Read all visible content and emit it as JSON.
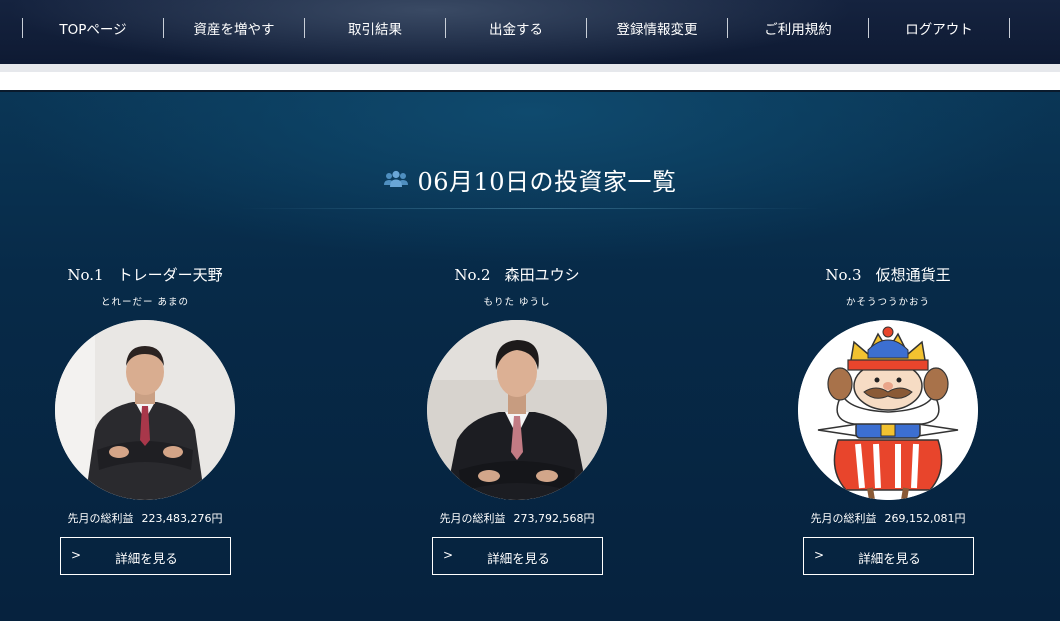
{
  "nav": {
    "items": [
      {
        "label": "TOPページ"
      },
      {
        "label": "資産を増やす"
      },
      {
        "label": "取引結果"
      },
      {
        "label": "出金する"
      },
      {
        "label": "登録情報変更"
      },
      {
        "label": "ご利用規約"
      },
      {
        "label": "ログアウト"
      }
    ]
  },
  "section": {
    "title": "06月10日の投資家一覧",
    "icon": "users-icon"
  },
  "investors": [
    {
      "rank": "No.1",
      "name": "トレーダー天野",
      "kana": "とれーだー あまの",
      "profit_label": "先月の総利益",
      "profit_value": "223,483,276円",
      "button_arrow": ">",
      "button_label": "詳細を見る",
      "avatar": "businessman-photo"
    },
    {
      "rank": "No.2",
      "name": "森田ユウシ",
      "kana": "もりた ゆうし",
      "profit_label": "先月の総利益",
      "profit_value": "273,792,568円",
      "button_arrow": ">",
      "button_label": "詳細を見る",
      "avatar": "young-man-photo"
    },
    {
      "rank": "No.3",
      "name": "仮想通貨王",
      "kana": "かそうつうかおう",
      "profit_label": "先月の総利益",
      "profit_value": "269,152,081円",
      "button_arrow": ">",
      "button_label": "詳細を見る",
      "avatar": "cartoon-king-illustration"
    }
  ],
  "colors": {
    "nav_bg": "#13213d",
    "main_bg": "#072a48",
    "text": "#ffffff",
    "accent_icon": "#4f8fc0"
  }
}
